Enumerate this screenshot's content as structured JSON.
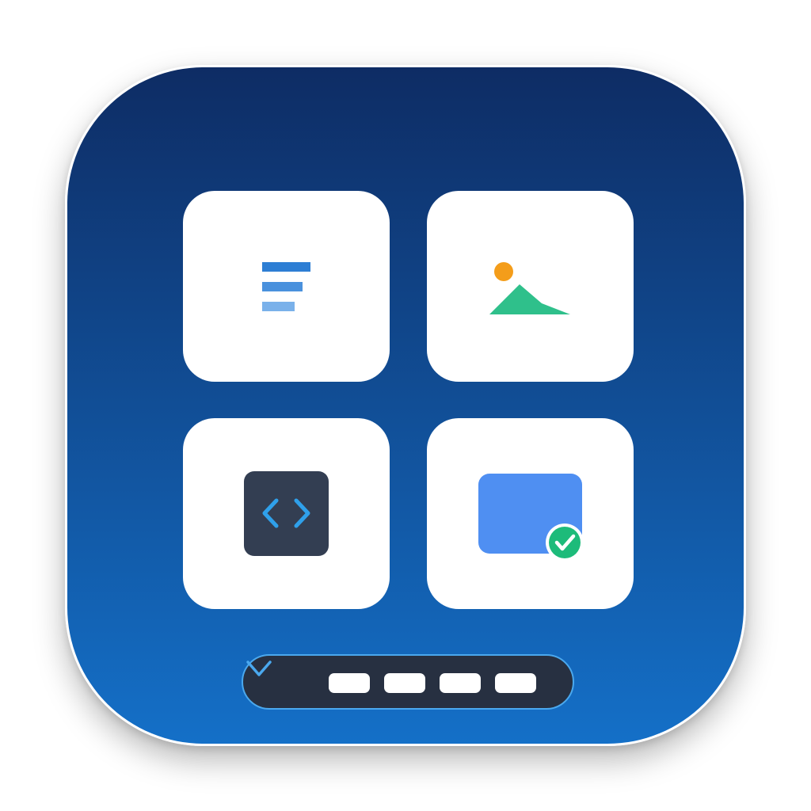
{
  "app_icon": {
    "gradient_top": "#0e2c64",
    "gradient_bottom": "#1470c8",
    "border_color": "#ffffff"
  },
  "tiles": [
    {
      "name": "text-document",
      "icon": "text-lines-icon",
      "colors": [
        "#2d7ed4",
        "#4a91dd",
        "#7ab1ea"
      ]
    },
    {
      "name": "image",
      "icon": "image-mountain-icon",
      "colors": {
        "sun": "#f49d1a",
        "mountain": "#2fc08b"
      }
    },
    {
      "name": "code",
      "icon": "code-brackets-icon",
      "colors": {
        "background": "#333e52",
        "brackets": "#2fa0ea"
      }
    },
    {
      "name": "screen-verified",
      "icon": "screen-check-icon",
      "colors": {
        "screen": "#4f8ff2",
        "badge": "#1dbb7a",
        "check": "#ffffff"
      }
    }
  ],
  "dock": {
    "icon": "chevron-down-icon",
    "background": "#273041",
    "border": "#4aa8ee",
    "slot_count": 4
  }
}
